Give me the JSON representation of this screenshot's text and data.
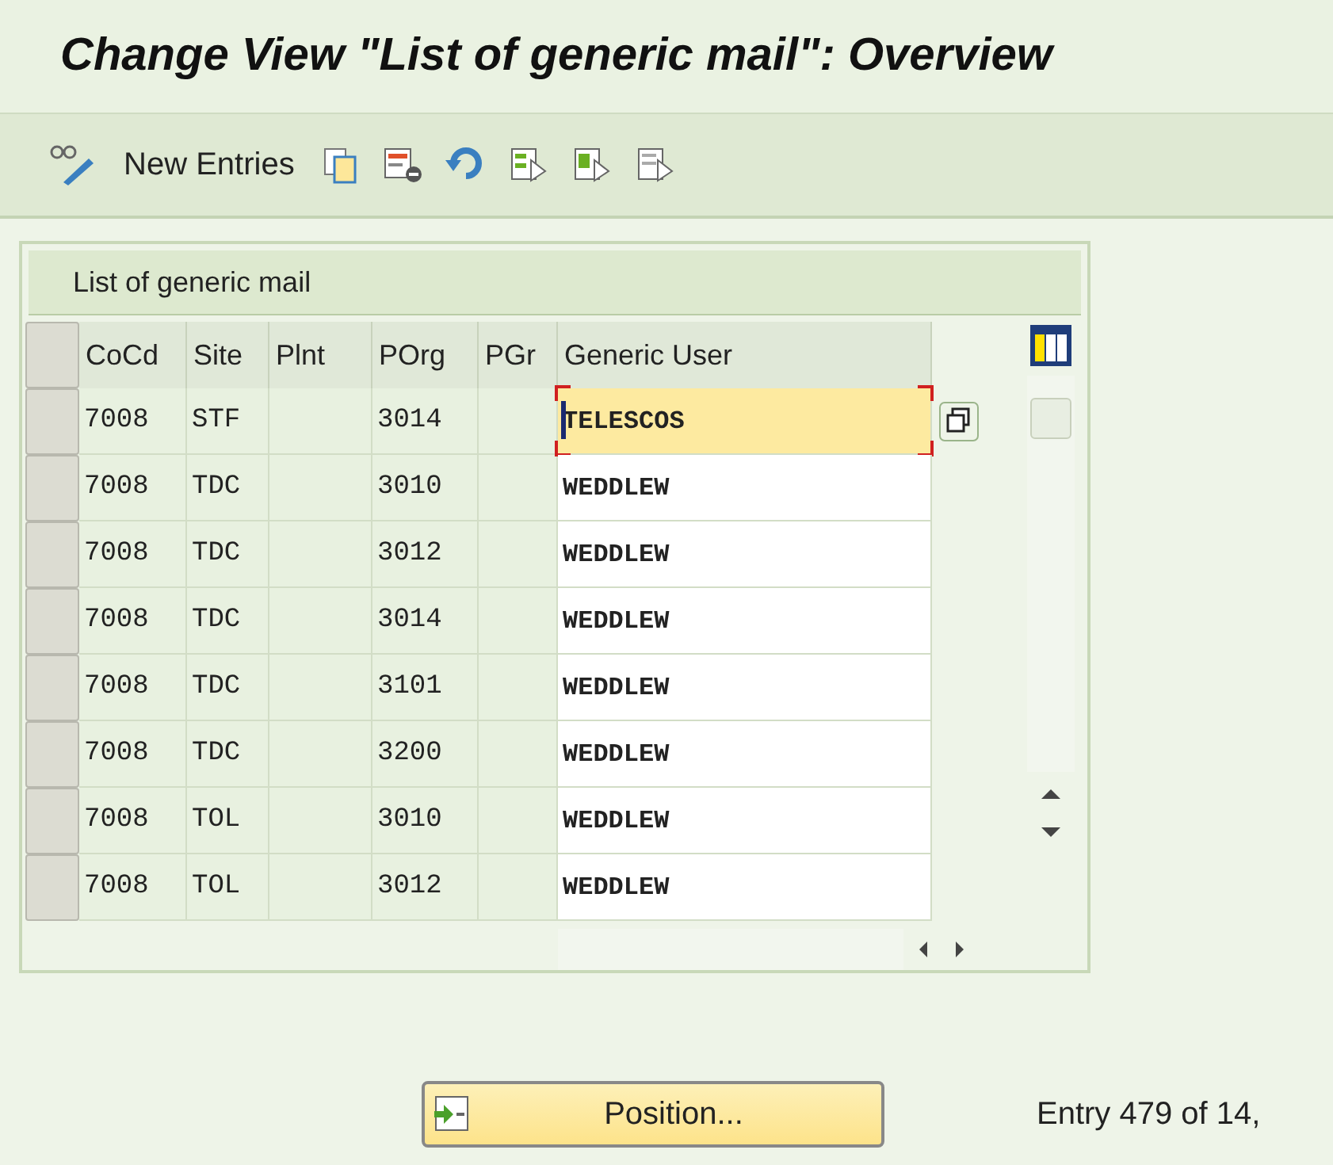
{
  "window": {
    "title": "Change View \"List of generic mail\": Overview"
  },
  "toolbar": {
    "new_entries": "New Entries"
  },
  "table": {
    "title": "List of generic mail",
    "columns": [
      "CoCd",
      "Site",
      "Plnt",
      "POrg",
      "PGr",
      "Generic User"
    ],
    "rows": [
      {
        "cells": [
          "7008",
          "STF",
          "",
          "3014",
          "",
          "TELESCOS"
        ],
        "focused": true
      },
      {
        "cells": [
          "7008",
          "TDC",
          "",
          "3010",
          "",
          "WEDDLEW"
        ],
        "focused": false
      },
      {
        "cells": [
          "7008",
          "TDC",
          "",
          "3012",
          "",
          "WEDDLEW"
        ],
        "focused": false
      },
      {
        "cells": [
          "7008",
          "TDC",
          "",
          "3014",
          "",
          "WEDDLEW"
        ],
        "focused": false
      },
      {
        "cells": [
          "7008",
          "TDC",
          "",
          "3101",
          "",
          "WEDDLEW"
        ],
        "focused": false
      },
      {
        "cells": [
          "7008",
          "TDC",
          "",
          "3200",
          "",
          "WEDDLEW"
        ],
        "focused": false
      },
      {
        "cells": [
          "7008",
          "TOL",
          "",
          "3010",
          "",
          "WEDDLEW"
        ],
        "focused": false
      },
      {
        "cells": [
          "7008",
          "TOL",
          "",
          "3012",
          "",
          "WEDDLEW"
        ],
        "focused": false
      }
    ]
  },
  "position_button": "Position...",
  "entry_info": "Entry 479 of 14,"
}
